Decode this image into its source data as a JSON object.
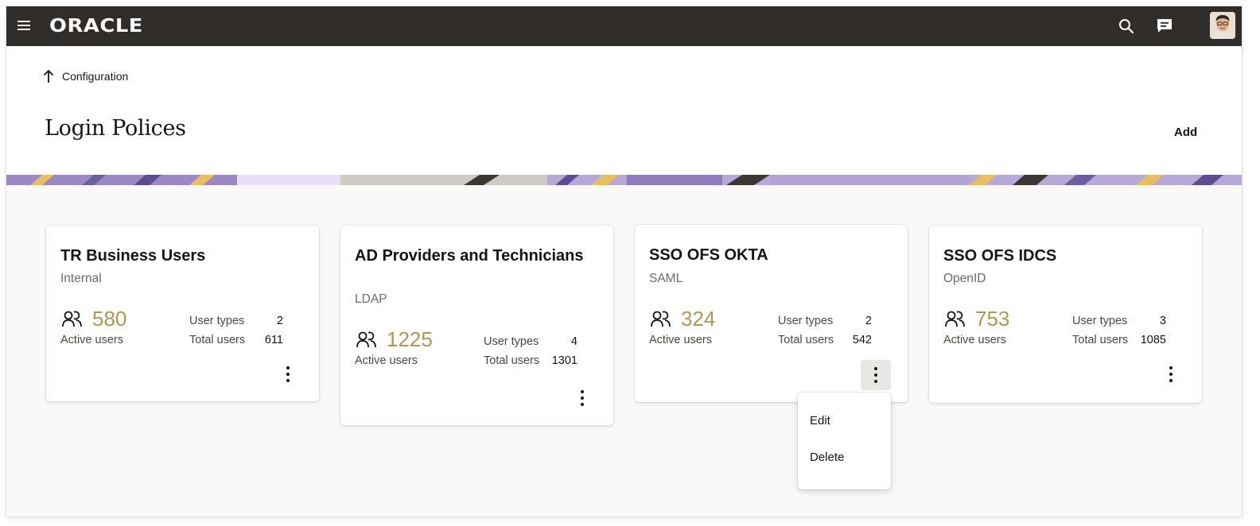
{
  "topbar": {
    "logo": "ORACLE",
    "icons": [
      "menu-icon",
      "search-icon",
      "chat-icon",
      "avatar"
    ]
  },
  "header": {
    "back_label": "Configuration",
    "title": "Login Polices",
    "add_label": "Add"
  },
  "colors": {
    "topbar_bg": "#312d2a",
    "accent_count": "#b09650",
    "page_bg": "#faf9f7"
  },
  "cards": [
    {
      "title": "TR Business Users",
      "subtitle": "Internal",
      "active_count": "580",
      "active_label": "Active users",
      "user_types_label": "User types",
      "user_types": "2",
      "total_users_label": "Total users",
      "total_users": "611"
    },
    {
      "title": "AD Providers and Technicians",
      "subtitle": "LDAP",
      "active_count": "1225",
      "active_label": "Active users",
      "user_types_label": "User types",
      "user_types": "4",
      "total_users_label": "Total users",
      "total_users": "1301"
    },
    {
      "title": "SSO OFS OKTA",
      "subtitle": "SAML",
      "active_count": "324",
      "active_label": "Active users",
      "user_types_label": "User types",
      "user_types": "2",
      "total_users_label": "Total users",
      "total_users": "542"
    },
    {
      "title": "SSO OFS IDCS",
      "subtitle": "OpenID",
      "active_count": "753",
      "active_label": "Active users",
      "user_types_label": "User types",
      "user_types": "3",
      "total_users_label": "Total users",
      "total_users": "1085"
    }
  ],
  "context_menu": {
    "items": [
      "Edit",
      "Delete"
    ]
  }
}
